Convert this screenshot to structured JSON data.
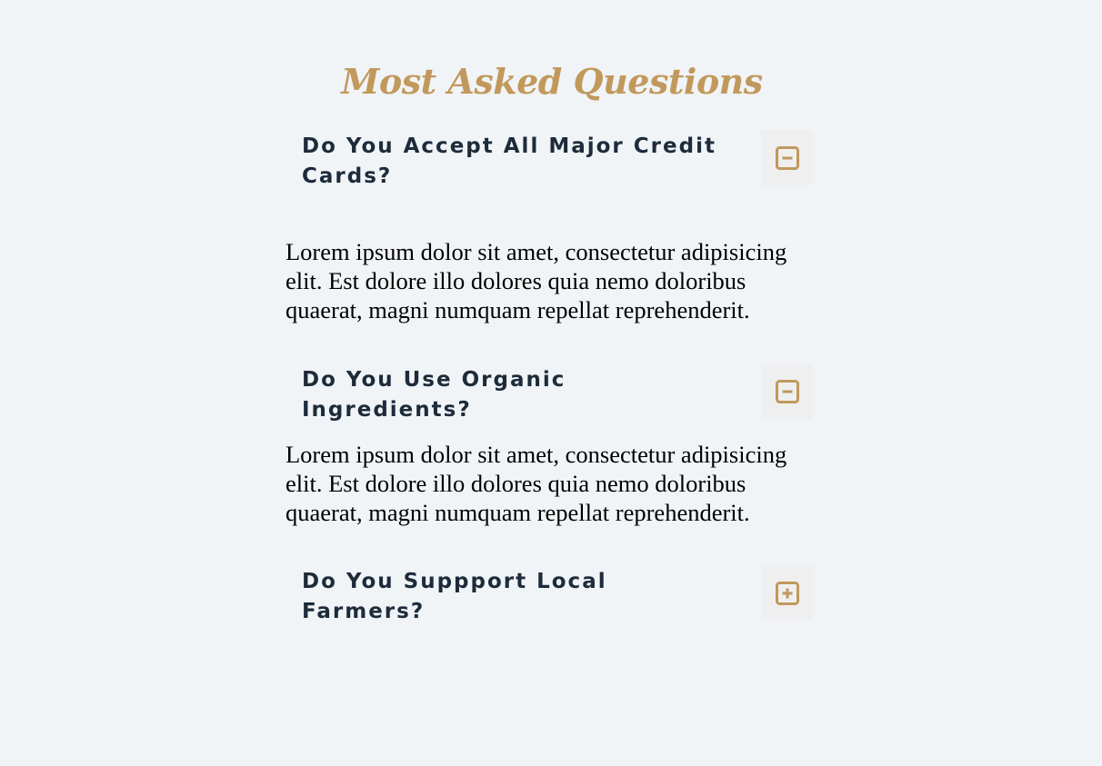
{
  "faq": {
    "title": "Most Asked Questions",
    "items": [
      {
        "question": "Do You Accept All Major Credit Cards?",
        "answer": "Lorem ipsum dolor sit amet, consectetur adipisicing elit. Est dolore illo dolores quia nemo doloribus quaerat, magni numquam repellat reprehenderit.",
        "toggle_icon": "minus-square-icon",
        "expanded": true
      },
      {
        "question": "Do You Use Organic Ingredients?",
        "answer": "Lorem ipsum dolor sit amet, consectetur adipisicing elit. Est dolore illo dolores quia nemo doloribus quaerat, magni numquam repellat reprehenderit.",
        "toggle_icon": "minus-square-icon",
        "expanded": true
      },
      {
        "question": "Do You Suppport Local Farmers?",
        "toggle_icon": "plus-square-icon",
        "expanded": false
      }
    ]
  },
  "colors": {
    "background": "#f1f4f7",
    "accent": "#c1995c",
    "question_text": "#1d2b3a",
    "toggle_bg": "#efefef"
  }
}
